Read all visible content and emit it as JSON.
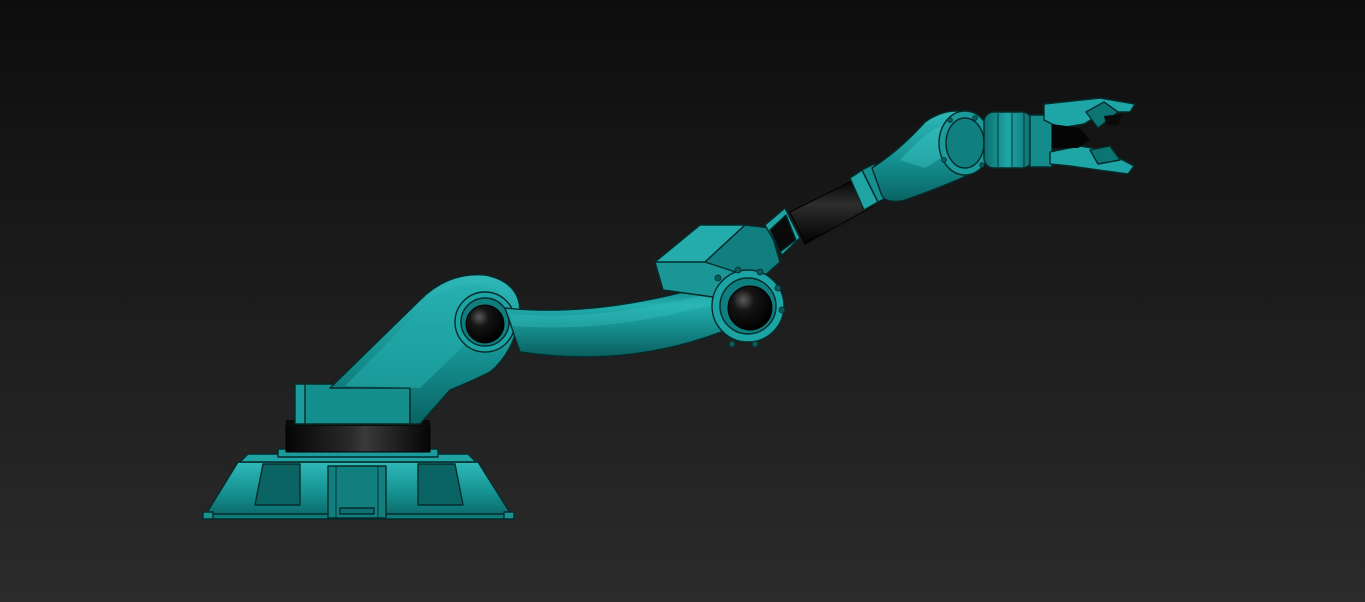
{
  "viewport": {
    "background_top": "#0d0d0d",
    "background_bottom": "#2b2b2b"
  },
  "model": {
    "body_color": "#1a9a9a",
    "body_light": "#3fc7c7",
    "body_dark": "#0b6b6b",
    "edge_color": "#062b2b",
    "black_part": "#050505",
    "parts": {
      "base": "base-pedestal",
      "turntable": "black-turntable-ring",
      "shoulder": "shoulder-bracket",
      "upper_arm": "curved-upper-arm",
      "elbow": "elbow-housing",
      "forearm": "black-forearm-shaft",
      "wrist": "wrist-assembly",
      "gripper": "two-finger-gripper"
    }
  }
}
